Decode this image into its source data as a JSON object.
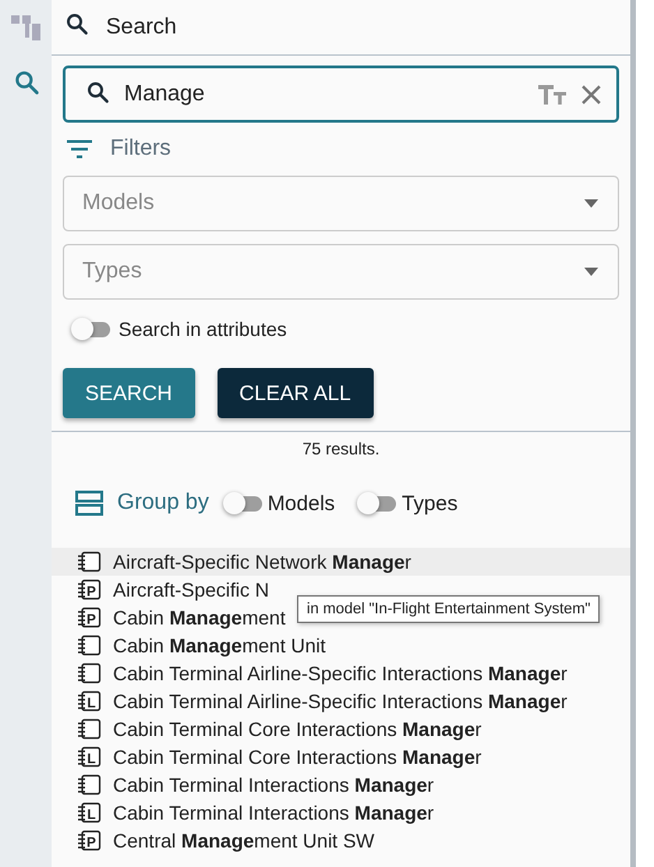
{
  "rail": {
    "items": [
      {
        "kind": "tree",
        "selected": false
      },
      {
        "kind": "search",
        "selected": true
      }
    ]
  },
  "header": {
    "title": "Search"
  },
  "search_field": {
    "value": "Manage",
    "case_sensitive": false
  },
  "filters": {
    "label": "Filters"
  },
  "dropdowns": [
    {
      "placeholder": "Models"
    },
    {
      "placeholder": "Types"
    }
  ],
  "attribute_toggle": {
    "label": "Search in attributes",
    "on": false
  },
  "buttons": [
    {
      "label": "SEARCH",
      "kind": "primary"
    },
    {
      "label": "CLEAR ALL",
      "kind": "dark"
    }
  ],
  "result_count": "75 results.",
  "group_by": {
    "label": "Group by",
    "toggles": [
      {
        "label": "Models",
        "on": false
      },
      {
        "label": "Types",
        "on": false
      }
    ]
  },
  "results": [
    {
      "text": "Aircraft-Specific Network **Manage**r",
      "hovered": true
    },
    {
      "text": "Aircraft-Specific N",
      "letter": "P",
      "hovered": false
    },
    {
      "text": "Cabin **Manage**ment",
      "letter": "P",
      "hovered": false
    },
    {
      "text": "Cabin **Manage**ment Unit",
      "hovered": false
    },
    {
      "text": "Cabin Terminal Airline-Specific Interactions **Manage**r",
      "hovered": false
    },
    {
      "text": "Cabin Terminal Airline-Specific Interactions **Manage**r",
      "letter": "L",
      "hovered": false
    },
    {
      "text": "Cabin Terminal Core Interactions **Manage**r",
      "hovered": false
    },
    {
      "text": "Cabin Terminal Core Interactions **Manage**r",
      "letter": "L",
      "hovered": false
    },
    {
      "text": "Cabin Terminal Interactions **Manage**r",
      "hovered": false
    },
    {
      "text": "Cabin Terminal Interactions **Manage**r",
      "letter": "L",
      "hovered": false
    },
    {
      "text": "Central **Manage**ment Unit SW",
      "letter": "P",
      "hovered": false
    }
  ],
  "tooltip": "in model \"In-Flight Entertainment System\""
}
